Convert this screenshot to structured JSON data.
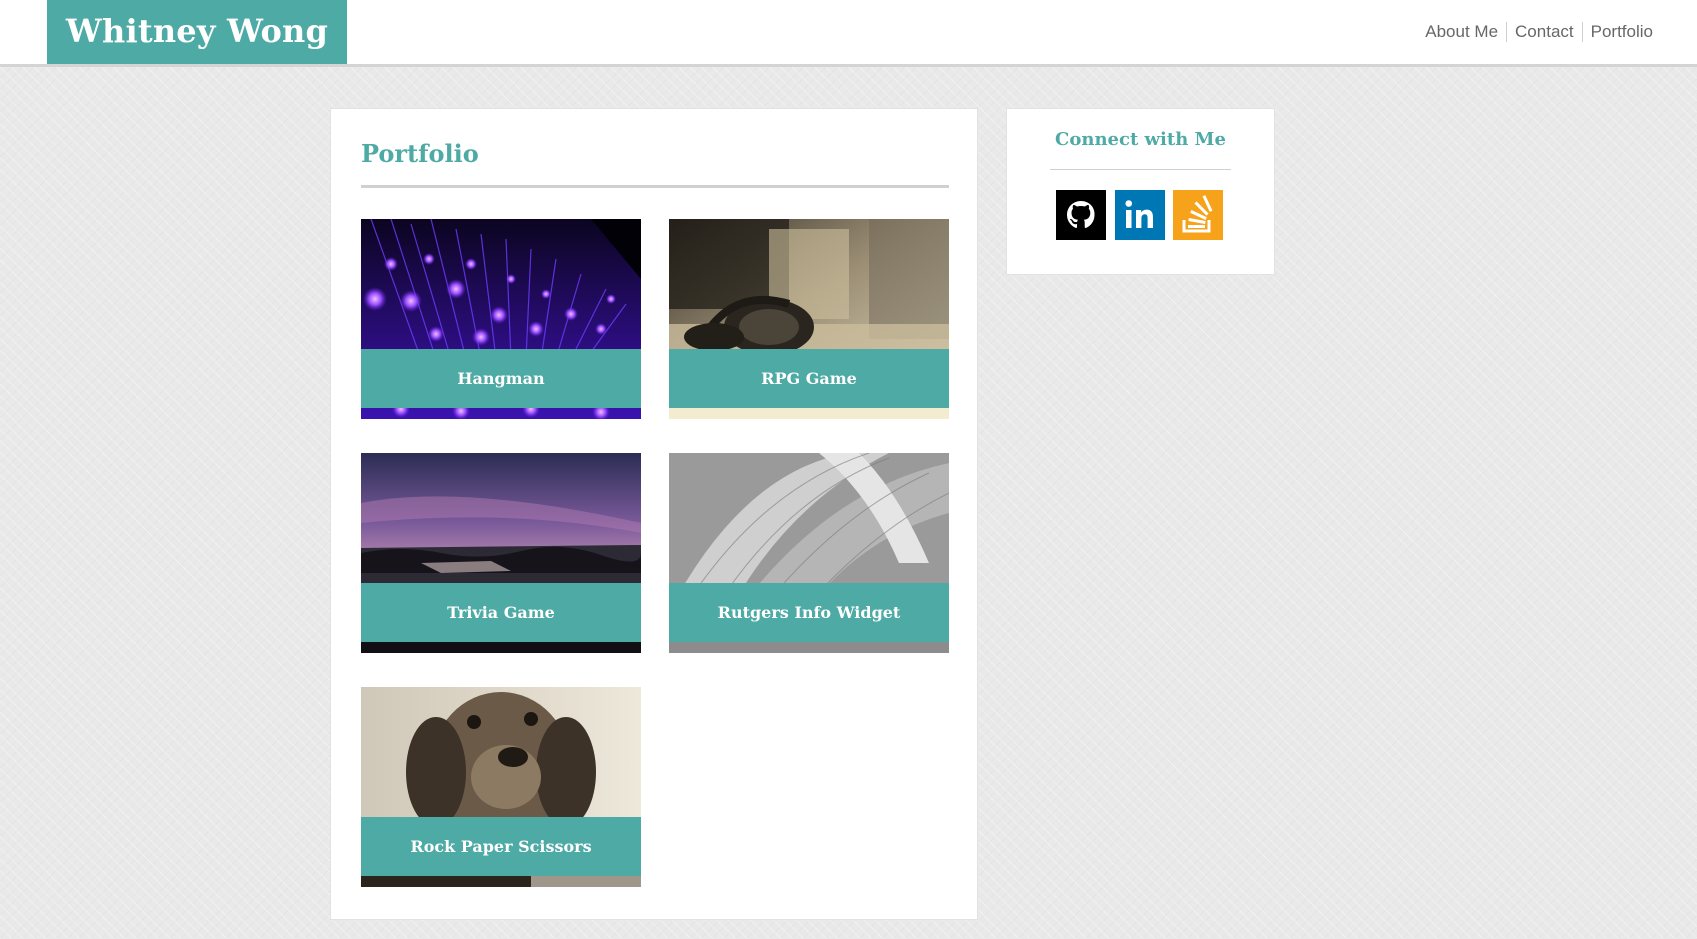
{
  "header": {
    "brand": "Whitney Wong",
    "nav": [
      "About Me",
      "Contact",
      "Portfolio"
    ]
  },
  "portfolio": {
    "title": "Portfolio",
    "items": [
      {
        "label": "Hangman",
        "image": "purple fiber optic lights"
      },
      {
        "label": "RPG Game",
        "image": "headphones on desk, sepia"
      },
      {
        "label": "Trivia Game",
        "image": "purple sunset over rocky shore"
      },
      {
        "label": "Rutgers Info Widget",
        "image": "black and white leaves"
      },
      {
        "label": "Rock Paper Scissors",
        "image": "sepia dog portrait"
      }
    ]
  },
  "connect": {
    "title": "Connect with Me",
    "links": [
      {
        "icon": "github-icon",
        "color": "#000000"
      },
      {
        "icon": "linkedin-icon",
        "color": "#0077b5"
      },
      {
        "icon": "stackoverflow-icon",
        "color": "#f7a21b"
      }
    ]
  },
  "colors": {
    "accent": "#4eaaa5",
    "background": "#e9e9e9",
    "card": "#ffffff"
  }
}
